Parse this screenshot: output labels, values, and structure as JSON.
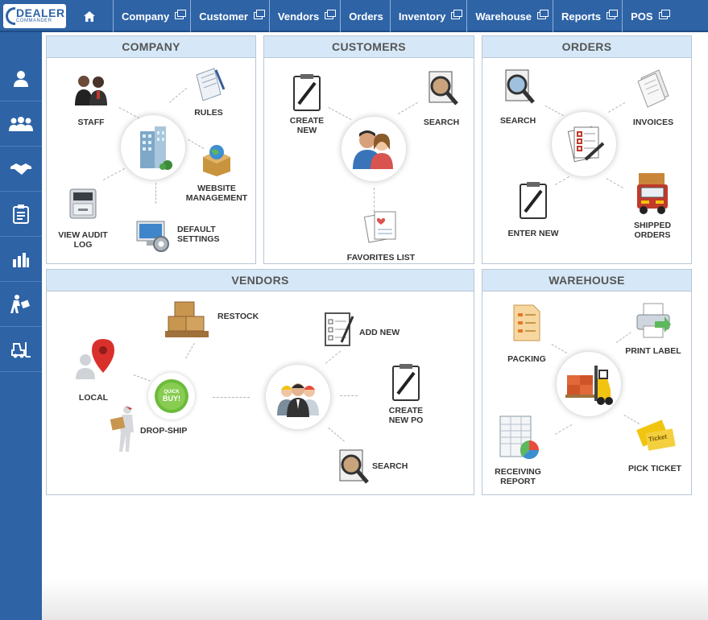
{
  "brand": {
    "main": "DEALER",
    "sub": "COMMANDER"
  },
  "nav": [
    {
      "label": "Company"
    },
    {
      "label": "Customer"
    },
    {
      "label": "Vendors"
    },
    {
      "label": "Orders"
    },
    {
      "label": "Inventory"
    },
    {
      "label": "Warehouse"
    },
    {
      "label": "Reports"
    },
    {
      "label": "POS"
    }
  ],
  "sidebar": {
    "icons": [
      "user-icon",
      "users-icon",
      "handshake-icon",
      "clipboard-icon",
      "bar-chart-icon",
      "delivery-person-icon",
      "forklift-icon"
    ]
  },
  "panels": {
    "company": {
      "title": "COMPANY",
      "staff": "STAFF",
      "rules": "RULES",
      "website": "WEBSITE\nMANAGEMENT",
      "audit": "VIEW AUDIT\nLOG",
      "defaults": "DEFAULT\nSETTINGS"
    },
    "customers": {
      "title": "CUSTOMERS",
      "create": "CREATE\nNEW",
      "search": "SEARCH",
      "favorites": "FAVORITES LIST"
    },
    "orders": {
      "title": "ORDERS",
      "search": "SEARCH",
      "invoices": "INVOICES",
      "enter": "ENTER NEW",
      "shipped": "SHIPPED\nORDERS"
    },
    "vendors": {
      "title": "VENDORS",
      "restock": "RESTOCK",
      "local": "LOCAL",
      "quick_buy": "QUICK\nBUY!",
      "dropship": "DROP-SHIP",
      "add": "ADD NEW",
      "create_po": "CREATE\nNEW PO",
      "search": "SEARCH"
    },
    "warehouse": {
      "title": "WAREHOUSE",
      "packing": "PACKING",
      "print": "PRINT LABEL",
      "receiving": "RECEIVING\nREPORT",
      "pick": "PICK TICKET",
      "ticket_word": "Ticket"
    }
  }
}
